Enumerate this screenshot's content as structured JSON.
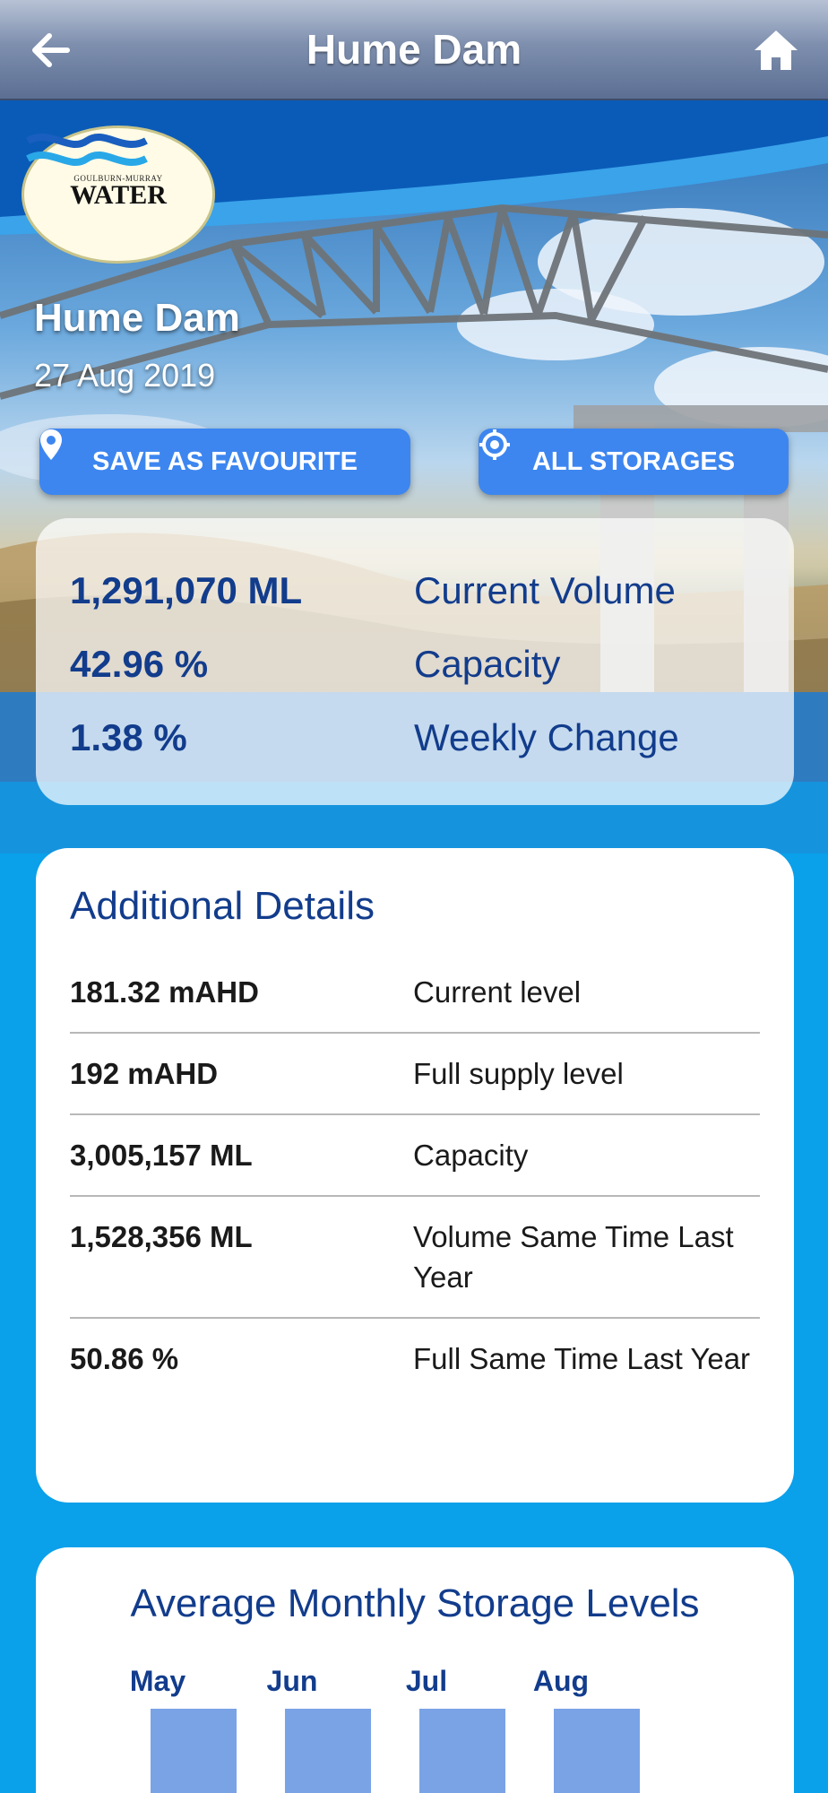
{
  "appbar": {
    "title": "Hume Dam",
    "back_icon": "arrow-left-icon",
    "home_icon": "home-icon"
  },
  "logo": {
    "small_text": "GOULBURN-MURRAY",
    "big_text": "WATER"
  },
  "hero": {
    "name": "Hume Dam",
    "date": "27 Aug 2019"
  },
  "buttons": {
    "favourite_label": "SAVE AS FAVOURITE",
    "favourite_icon": "map-pin-icon",
    "all_storages_label": "ALL STORAGES",
    "all_storages_icon": "target-icon"
  },
  "summary": [
    {
      "value": "1,291,070 ML",
      "label": "Current Volume"
    },
    {
      "value": "42.96 %",
      "label": "Capacity"
    },
    {
      "value": "1.38 %",
      "label": "Weekly Change"
    }
  ],
  "details": {
    "title": "Additional Details",
    "rows": [
      {
        "value": "181.32 mAHD",
        "label": "Current level"
      },
      {
        "value": "192 mAHD",
        "label": "Full supply level"
      },
      {
        "value": "3,005,157 ML",
        "label": "Capacity"
      },
      {
        "value": "1,528,356 ML",
        "label": "Volume Same Time Last Year"
      },
      {
        "value": "50.86 %",
        "label": "Full Same Time Last Year"
      }
    ]
  },
  "chart": {
    "title": "Average Monthly Storage Levels"
  },
  "chart_data": {
    "type": "bar",
    "title": "Average Monthly Storage Levels",
    "categories": [
      "May",
      "Jun",
      "Jul",
      "Aug"
    ],
    "bar_color": "#7aa3e6"
  },
  "colors": {
    "accent_blue": "#3d86f0",
    "text_navy": "#123c8c",
    "background_blue": "#0aa0ea"
  }
}
